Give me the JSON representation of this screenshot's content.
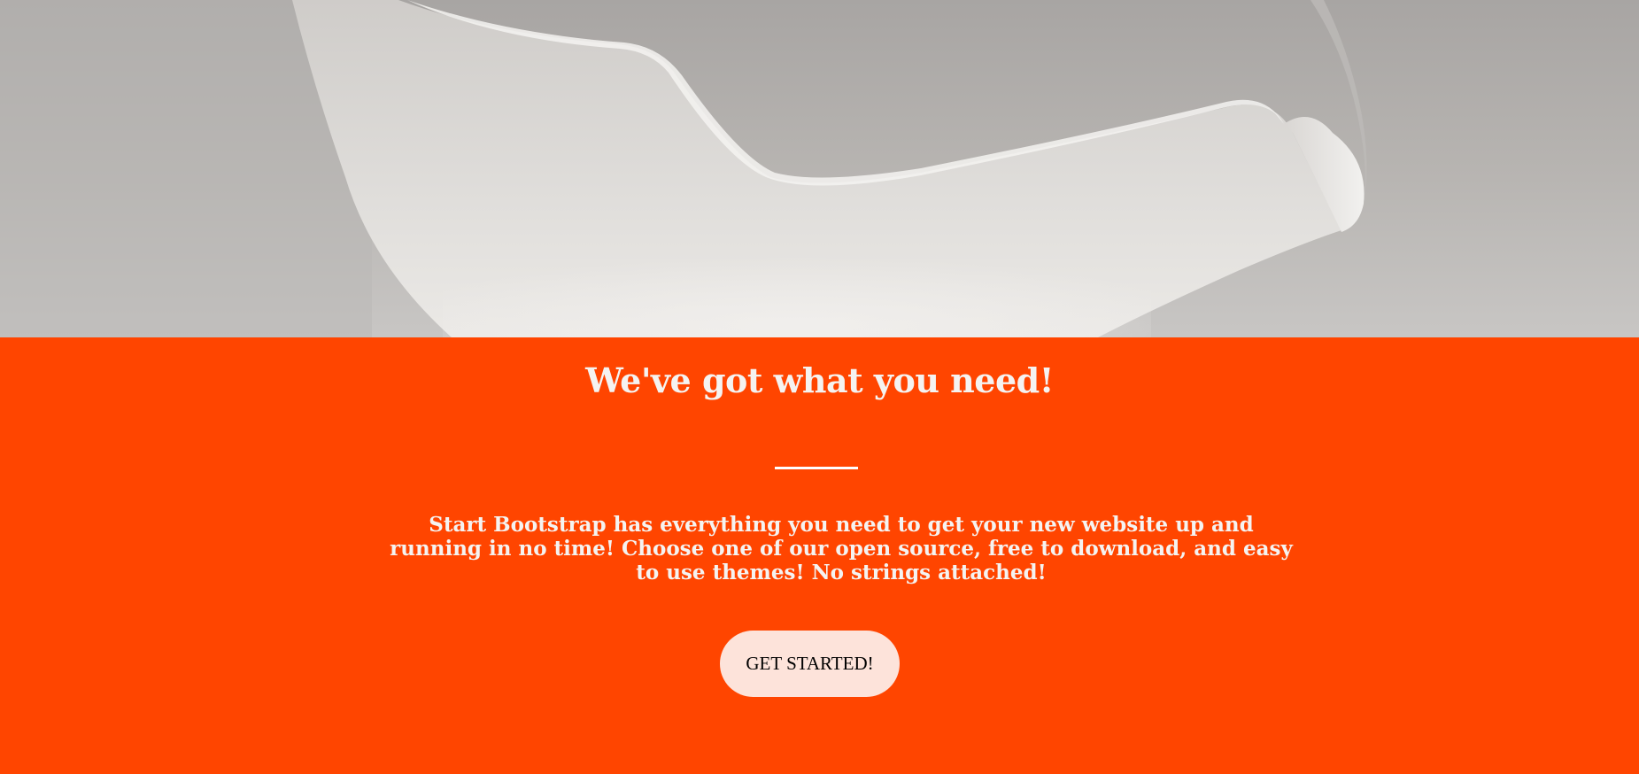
{
  "header": {
    "background_image": "curved-white-object-photo"
  },
  "about": {
    "heading": "We've got what you need!",
    "description": "Start Bootstrap has everything you need to get your new website up and running in no time! Choose one of our open source, free to download, and easy to use themes! No strings attached!",
    "cta_label": "GET STARTED!",
    "background_color": "#ff4500",
    "button_color": "#fde3da"
  }
}
